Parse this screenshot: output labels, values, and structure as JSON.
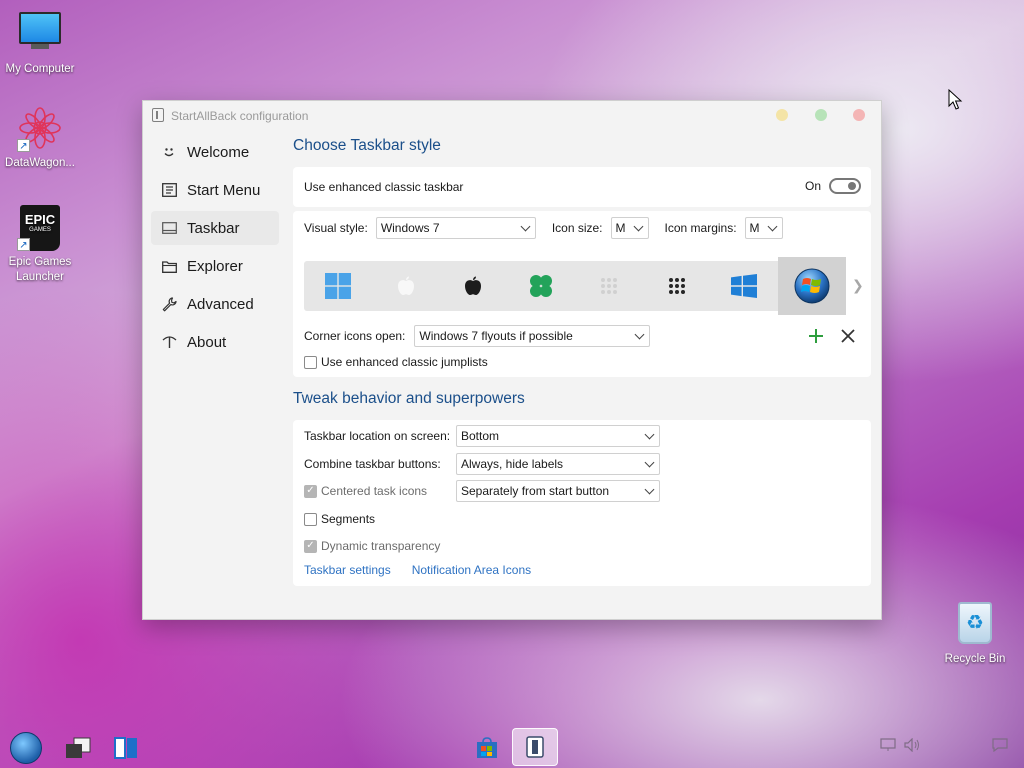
{
  "desktop": {
    "icons": [
      {
        "label": "My Computer"
      },
      {
        "label": "DataWagon..."
      },
      {
        "label": "Epic Games Launcher"
      },
      {
        "label": "Recycle Bin"
      }
    ],
    "epic_logo": {
      "line1": "EPIC",
      "line2": "GAMES"
    }
  },
  "window": {
    "title": "StartAllBack configuration",
    "sidebar": [
      {
        "label": "Welcome",
        "icon": "smiley-icon",
        "active": false
      },
      {
        "label": "Start Menu",
        "icon": "start-menu-icon",
        "active": false
      },
      {
        "label": "Taskbar",
        "icon": "taskbar-icon",
        "active": true
      },
      {
        "label": "Explorer",
        "icon": "folder-icon",
        "active": false
      },
      {
        "label": "Advanced",
        "icon": "wrench-icon",
        "active": false
      },
      {
        "label": "About",
        "icon": "about-icon",
        "active": false
      }
    ],
    "taskbar_style": {
      "title": "Choose Taskbar style",
      "enhanced_label": "Use enhanced classic taskbar",
      "enhanced_state": "On",
      "visual_style_label": "Visual style:",
      "visual_style_value": "Windows 7",
      "icon_size_label": "Icon size:",
      "icon_size_value": "M",
      "icon_margins_label": "Icon margins:",
      "icon_margins_value": "M",
      "start_styles": [
        "windows-11-logo",
        "apple-light",
        "apple-dark",
        "clover",
        "dots-light",
        "dots-dark",
        "windows-10-logo",
        "windows-7-orb"
      ],
      "selected_style": 7,
      "corner_icons_label": "Corner icons open:",
      "corner_icons_value": "Windows 7 flyouts if possible",
      "jumplists_label": "Use enhanced classic jumplists",
      "jumplists_checked": false
    },
    "tweak": {
      "title": "Tweak behavior and superpowers",
      "location_label": "Taskbar location on screen:",
      "location_value": "Bottom",
      "combine_label": "Combine taskbar buttons:",
      "combine_value": "Always, hide labels",
      "centered_label": "Centered task icons",
      "centered_value": "Separately from start button",
      "centered_checked": true,
      "segments_label": "Segments",
      "segments_checked": false,
      "transparency_label": "Dynamic transparency",
      "transparency_checked": true,
      "link_taskbar_settings": "Taskbar settings",
      "link_notification_icons": "Notification Area Icons"
    }
  },
  "colors": {
    "accent_title": "#1b4f8a",
    "link": "#2f73c3",
    "add_icon": "#2e9e3e",
    "remove_icon": "#333333"
  }
}
